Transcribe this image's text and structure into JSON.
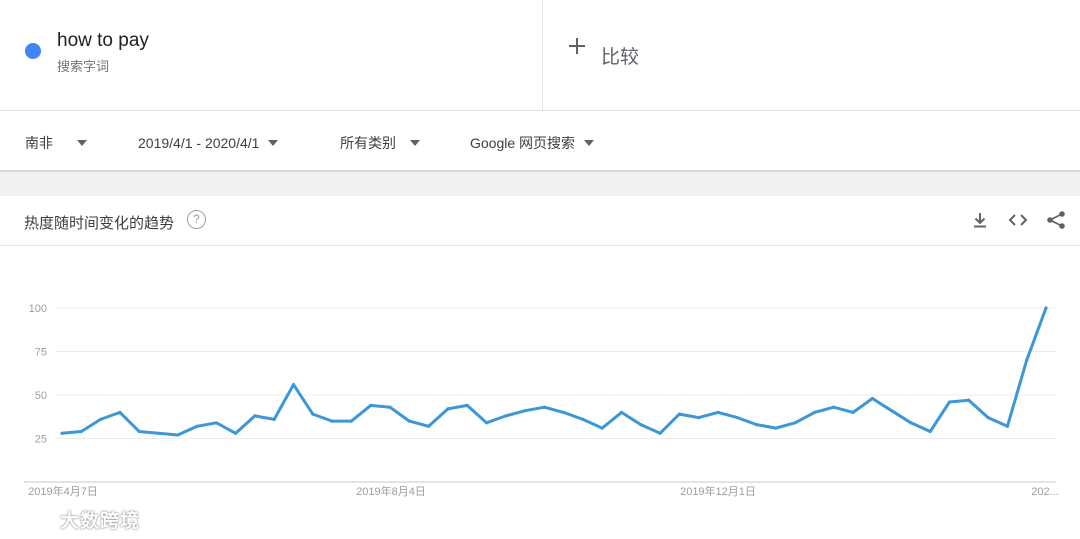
{
  "search_term": {
    "name": "how to pay",
    "type_label": "搜索字词",
    "color": "#4285f4"
  },
  "compare": {
    "label": "比较",
    "icon": "plus-icon"
  },
  "filters": {
    "region": "南非",
    "date_range": "2019/4/1 - 2020/4/1",
    "category": "所有类别",
    "search_type": "Google 网页搜索"
  },
  "card": {
    "title": "热度随时间变化的趋势",
    "help_icon": "question-circle-icon",
    "actions": [
      "download-icon",
      "embed-code-icon",
      "share-icon"
    ]
  },
  "chart_data": {
    "type": "line",
    "title": "",
    "xlabel": "",
    "ylabel": "",
    "ylim": [
      0,
      100
    ],
    "yticks": [
      25,
      50,
      75,
      100
    ],
    "x_ticks": [
      "2019年4月7日",
      "2019年8月4日",
      "2019年12月1日",
      "202..."
    ],
    "grid": true,
    "series": [
      {
        "color": "#3c97d6",
        "values": [
          28,
          29,
          36,
          40,
          29,
          28,
          27,
          32,
          34,
          28,
          38,
          36,
          56,
          39,
          35,
          35,
          44,
          43,
          35,
          32,
          42,
          44,
          34,
          38,
          41,
          43,
          40,
          36,
          31,
          40,
          33,
          28,
          39,
          37,
          40,
          37,
          33,
          31,
          34,
          40,
          43,
          40,
          48,
          41,
          34,
          29,
          46,
          47,
          37,
          32,
          70,
          100
        ]
      }
    ]
  },
  "watermark": {
    "text": "大数跨境"
  }
}
